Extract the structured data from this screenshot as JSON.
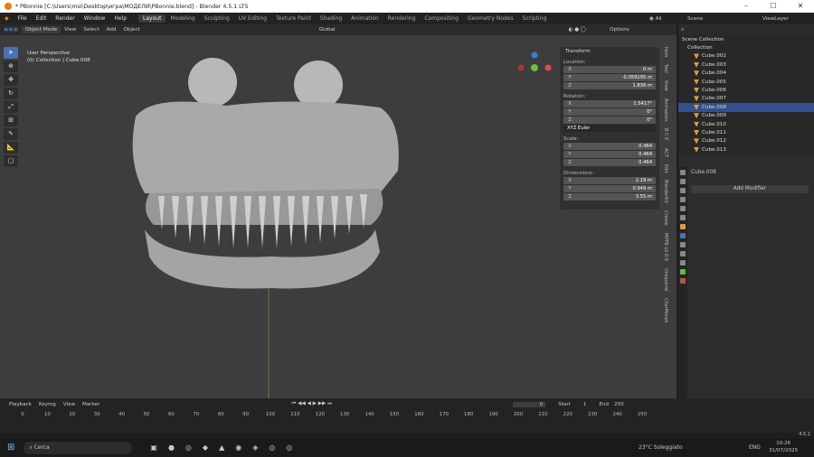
{
  "window": {
    "title": "* PBonnie [C:\\Users\\msi\\Desktop\\игра\\МОДЕЛИ\\PBonnie.blend] - Blender 4.5.1 LTS"
  },
  "menu": [
    "File",
    "Edit",
    "Render",
    "Window",
    "Help"
  ],
  "workspaces": [
    "Layout",
    "Modeling",
    "Sculpting",
    "UV Editing",
    "Texture Paint",
    "Shading",
    "Animation",
    "Rendering",
    "Compositing",
    "Geometry Nodes",
    "Scripting"
  ],
  "topright": {
    "scene_label": "Scene",
    "viewlayer_label": "ViewLayer"
  },
  "header": {
    "mode": "Object Mode",
    "view": "View",
    "select": "Select",
    "add": "Add",
    "object": "Object",
    "orientation": "Global",
    "options": "Options"
  },
  "viewport": {
    "perspective": "User Perspective",
    "collection": "(0) Collection | Cube.008"
  },
  "transform": {
    "title": "Transform",
    "location_label": "Location:",
    "location": {
      "x": "0 m",
      "y": "-0.059195 m",
      "z": "1.836 m"
    },
    "rotation_label": "Rotation:",
    "rotation": {
      "x": "1.5417°",
      "y": "0°",
      "z": "0°"
    },
    "rotation_mode": "XYZ Euler",
    "scale_label": "Scale:",
    "scale": {
      "x": "0.464",
      "y": "0.464",
      "z": "0.464"
    },
    "dimensions_label": "Dimensions:",
    "dimensions": {
      "x": "2.19 m",
      "y": "0.949 m",
      "z": "3.55 m"
    }
  },
  "side_tabs": [
    "Item",
    "Tool",
    "View",
    "Animation",
    "B C E",
    "ACT",
    "Edit",
    "BlenderKit",
    "Create",
    "MPFB v2.0.9",
    "Unsquirrel",
    "CharMorph"
  ],
  "outliner": {
    "root": "Scene Collection",
    "collection": "Collection",
    "items": [
      "Cube.002",
      "Cube.003",
      "Cube.004",
      "Cube.005",
      "Cube.006",
      "Cube.007",
      "Cube.008",
      "Cube.009",
      "Cube.010",
      "Cube.011",
      "Cube.012",
      "Cube.013"
    ],
    "selected_index": 6
  },
  "properties": {
    "object_name": "Cube.008",
    "add_modifier": "Add Modifier"
  },
  "timeline": {
    "menu": [
      "Playback",
      "Keying",
      "View",
      "Marker"
    ],
    "current_frame": "0",
    "start_label": "Start",
    "start": "1",
    "end_label": "End",
    "end": "250",
    "ticks": [
      "0",
      "10",
      "20",
      "30",
      "40",
      "50",
      "60",
      "70",
      "80",
      "90",
      "100",
      "110",
      "120",
      "130",
      "140",
      "150",
      "160",
      "170",
      "180",
      "190",
      "200",
      "210",
      "220",
      "230",
      "240",
      "250"
    ]
  },
  "status": {
    "version": "4.5.1"
  },
  "taskbar": {
    "search": "Cerca",
    "weather_temp": "23°C",
    "weather_text": "Soleggiato",
    "lang": "ENG",
    "time": "10:26",
    "date": "31/07/2025"
  },
  "colors": {
    "accent": "#4772b3",
    "orange": "#e87d0d",
    "selected": "#33508a"
  }
}
